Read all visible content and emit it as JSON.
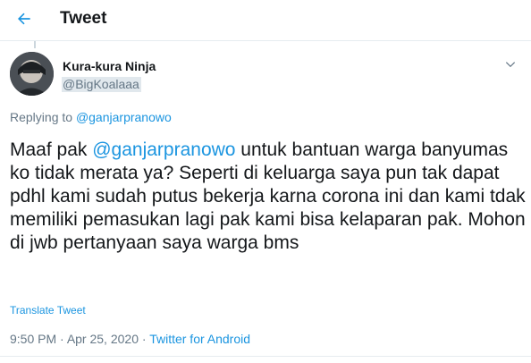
{
  "header": {
    "title": "Tweet"
  },
  "author": {
    "name": "Kura-kura Ninja",
    "handle": "@BigKoalaaa"
  },
  "replying": {
    "prefix": "Replying to",
    "mention": "@ganjarpranowo"
  },
  "tweet": {
    "prefix": "Maaf pak ",
    "mention": "@ganjarpranowo",
    "body": "  untuk bantuan warga banyumas ko tidak merata ya? Seperti di keluarga saya pun tak dapat pdhl kami sudah putus bekerja karna corona ini dan kami tdak memiliki pemasukan lagi pak kami bisa kelaparan pak. Mohon di jwb pertanyaan saya warga bms"
  },
  "translate_label": "Translate Tweet",
  "meta": {
    "time": "9:50 PM",
    "separator1": " · ",
    "date": "Apr 25, 2020",
    "separator2": " · ",
    "source": "Twitter for Android"
  },
  "colors": {
    "accent": "#1b95e0",
    "text": "#14171a",
    "muted": "#657786",
    "border": "#e6ecf0"
  },
  "icons": {
    "back": "arrow-left-icon",
    "more": "chevron-down-icon"
  }
}
